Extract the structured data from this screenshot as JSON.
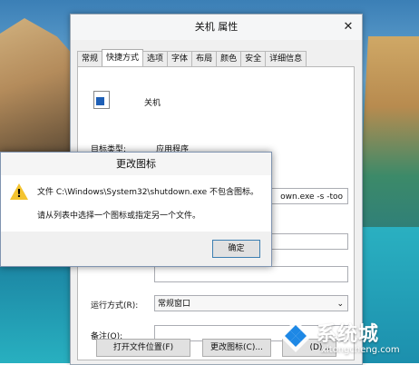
{
  "window": {
    "title": "关机 属性",
    "close_glyph": "✕",
    "tabs": [
      {
        "label": "常规"
      },
      {
        "label": "快捷方式",
        "active": true
      },
      {
        "label": "选项"
      },
      {
        "label": "字体"
      },
      {
        "label": "布局"
      },
      {
        "label": "颜色"
      },
      {
        "label": "安全"
      },
      {
        "label": "详细信息"
      }
    ],
    "shortcut": {
      "name": "关机",
      "target_type_label": "目标类型:",
      "target_type_value": "应用程序",
      "target_value": "own.exe -s -too",
      "run_label": "运行方式(R):",
      "run_value": "常规窗口",
      "comment_label": "备注(O):",
      "comment_value": "",
      "open_location_button": "打开文件位置(F)",
      "change_icon_button": "更改图标(C)...",
      "advanced_button": "(D)..."
    }
  },
  "dialog": {
    "title": "更改图标",
    "message_line1": "文件 C:\\Windows\\System32\\shutdown.exe 不包含图标。",
    "message_line2": "请从列表中选择一个图标或指定另一个文件。",
    "ok_button": "确定"
  },
  "watermark": {
    "name": "系统城",
    "url": "xitongcheng.com"
  },
  "colors": {
    "accent": "#3c7fb1",
    "warning": "#f4c430"
  }
}
